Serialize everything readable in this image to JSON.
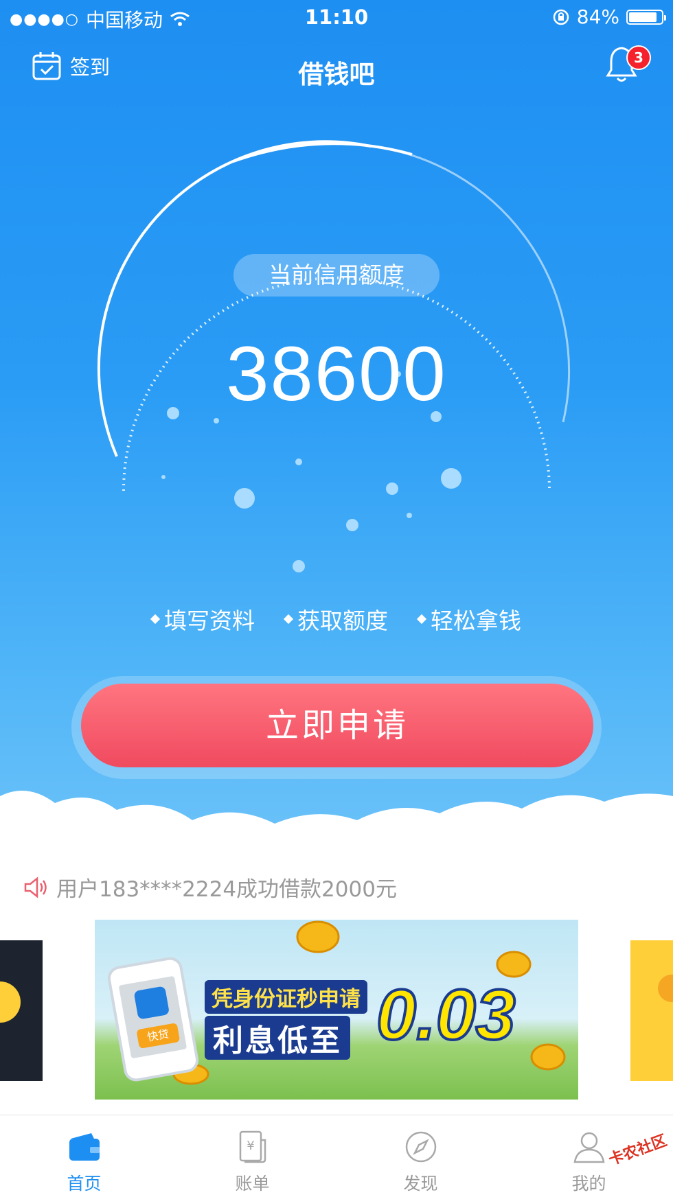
{
  "status_bar": {
    "carrier": "中国移动",
    "time": "11:10",
    "battery": "84%",
    "battery_level": 0.84
  },
  "nav": {
    "checkin_label": "签到",
    "title": "借钱吧",
    "notification_count": "3"
  },
  "credit": {
    "label": "当前信用额度",
    "amount": "38600"
  },
  "steps": [
    "填写资料",
    "获取额度",
    "轻松拿钱"
  ],
  "apply_button": "立即申请",
  "notice": "用户183****2224成功借款2000元",
  "banner": {
    "line1": "凭身份证秒申请",
    "line2": "利息低至",
    "rate": "0.03",
    "phone_tag": "快贷"
  },
  "tabs": [
    {
      "label": "首页",
      "icon": "wallet-icon",
      "active": true
    },
    {
      "label": "账单",
      "icon": "bill-icon",
      "active": false
    },
    {
      "label": "发现",
      "icon": "compass-icon",
      "active": false
    },
    {
      "label": "我的",
      "icon": "user-icon",
      "active": false
    }
  ],
  "colors": {
    "primary": "#1e8ff2",
    "button": "#f04a5f",
    "badge": "#f5222d"
  },
  "watermark": "卡农社区"
}
